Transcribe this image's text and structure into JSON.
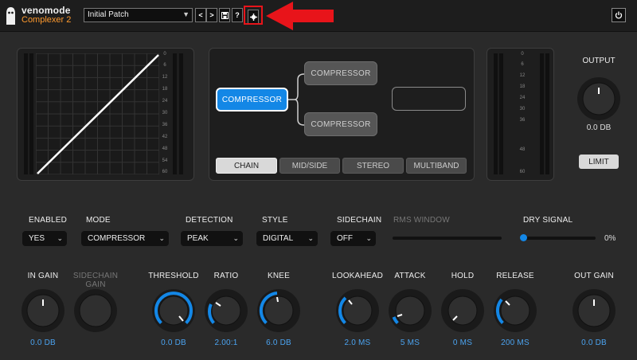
{
  "header": {
    "brand": "venomode",
    "product": "Complexer 2",
    "patch": "Initial Patch",
    "buttons": {
      "prev": "<",
      "next": ">",
      "help": "?"
    }
  },
  "curve": {
    "scale": [
      "0",
      "6",
      "12",
      "18",
      "24",
      "30",
      "36",
      "42",
      "48",
      "54",
      "60"
    ]
  },
  "routing": {
    "compressors": [
      {
        "label": "COMPRESSOR",
        "active": true
      },
      {
        "label": "COMPRESSOR",
        "active": false
      },
      {
        "label": "COMPRESSOR",
        "active": false
      }
    ],
    "tabs": [
      "CHAIN",
      "MID/SIDE",
      "STEREO",
      "MULTIBAND"
    ],
    "active_tab": "CHAIN"
  },
  "meter_scale": [
    "0",
    "6",
    "12",
    "18",
    "24",
    "30",
    "36",
    "48",
    "60"
  ],
  "output": {
    "label": "OUTPUT",
    "value": "0.0 DB",
    "limit_label": "LIMIT"
  },
  "controls": {
    "enabled": {
      "label": "ENABLED",
      "value": "YES"
    },
    "mode": {
      "label": "MODE",
      "value": "COMPRESSOR"
    },
    "detection": {
      "label": "DETECTION",
      "value": "PEAK"
    },
    "style": {
      "label": "STYLE",
      "value": "DIGITAL"
    },
    "sidechain": {
      "label": "SIDECHAIN",
      "value": "OFF"
    },
    "rms_window": {
      "label": "RMS WINDOW"
    },
    "dry_signal": {
      "label": "DRY SIGNAL",
      "value": "0%"
    }
  },
  "knobs": [
    {
      "id": "in-gain",
      "label": "IN GAIN",
      "value": "0.0 DB",
      "dim": false
    },
    {
      "id": "sidechain-gain",
      "label": "SIDECHAIN GAIN",
      "value": "",
      "dim": true
    },
    {
      "id": "threshold",
      "label": "THRESHOLD",
      "value": "0.0 DB",
      "dim": false
    },
    {
      "id": "ratio",
      "label": "RATIO",
      "value": "2.00:1",
      "dim": false
    },
    {
      "id": "knee",
      "label": "KNEE",
      "value": "6.0 DB",
      "dim": false
    },
    {
      "id": "lookahead",
      "label": "LOOKAHEAD",
      "value": "2.0 MS",
      "dim": false
    },
    {
      "id": "attack",
      "label": "ATTACK",
      "value": "5 MS",
      "dim": false
    },
    {
      "id": "hold",
      "label": "HOLD",
      "value": "0 MS",
      "dim": false
    },
    {
      "id": "release",
      "label": "RELEASE",
      "value": "200 MS",
      "dim": false
    },
    {
      "id": "out-gain",
      "label": "OUT GAIN",
      "value": "0.0 DB",
      "dim": false
    }
  ],
  "colors": {
    "accent": "#1387e6",
    "brand": "#ff9a2e",
    "highlight": "#e8141a",
    "value_text": "#4ba3f0"
  }
}
